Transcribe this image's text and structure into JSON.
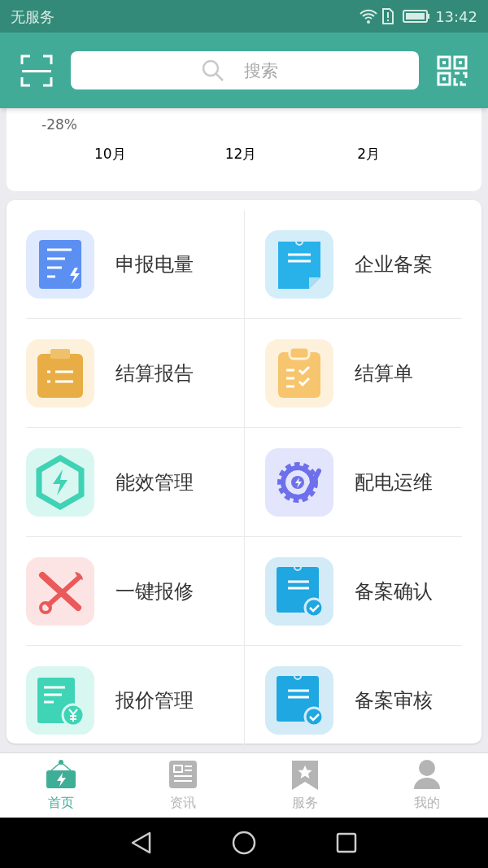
{
  "status_bar": {
    "carrier": "无服务",
    "time": "13:42"
  },
  "header": {
    "search": {
      "placeholder": "搜索"
    }
  },
  "chart": {
    "y_tick": "-28%",
    "x_labels": [
      "10月",
      "12月",
      "2月"
    ]
  },
  "services": [
    {
      "label": "申报电量",
      "kind": "report"
    },
    {
      "label": "企业备案",
      "kind": "memo"
    },
    {
      "label": "结算报告",
      "kind": "clipboard"
    },
    {
      "label": "结算单",
      "kind": "checklist"
    },
    {
      "label": "能效管理",
      "kind": "hexagon"
    },
    {
      "label": "配电运维",
      "kind": "gear"
    },
    {
      "label": "一键报修",
      "kind": "tools"
    },
    {
      "label": "备案确认",
      "kind": "approval"
    },
    {
      "label": "报价管理",
      "kind": "invoice"
    },
    {
      "label": "备案审核",
      "kind": "approval"
    }
  ],
  "tabs": [
    {
      "label": "首页",
      "kind": "home",
      "selected": true
    },
    {
      "label": "资讯",
      "kind": "news",
      "selected": false
    },
    {
      "label": "服务",
      "kind": "bookmark",
      "selected": false
    },
    {
      "label": "我的",
      "kind": "person",
      "selected": false
    }
  ]
}
